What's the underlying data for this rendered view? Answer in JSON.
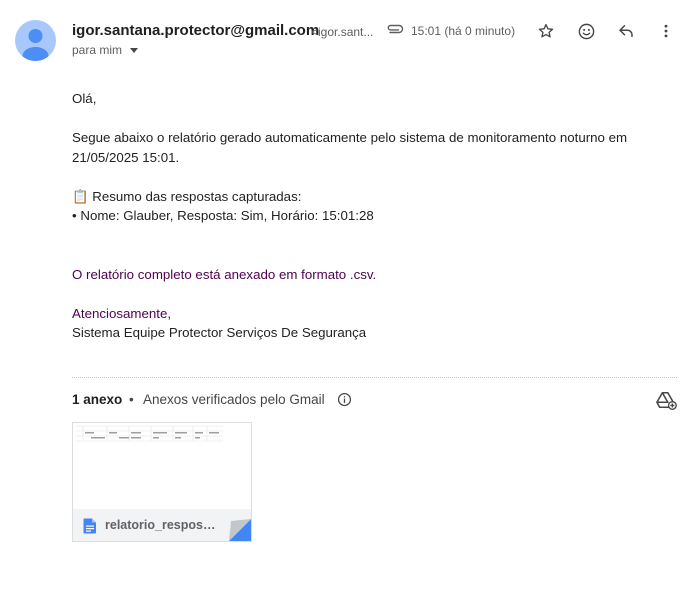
{
  "header": {
    "sender_name": "igor.santana.protector@gmail.com",
    "sender_email": "<igor.sant...",
    "to_line": "para mim",
    "timestamp": "15:01 (há 0 minuto)"
  },
  "icons": {
    "avatar": "person-icon",
    "attachment": "paperclip-icon",
    "star": "star-icon",
    "react": "emoji-icon",
    "reply": "reply-icon",
    "more": "more-vert-icon",
    "info": "info-icon",
    "drive": "add-to-drive-icon",
    "file": "file-icon"
  },
  "body": {
    "greeting": "Olá,",
    "line1": "Segue abaixo o relatório gerado automaticamente pelo sistema de monitoramento noturno em 21/05/2025 15:01.",
    "summary_title": "📋 Resumo das respostas capturadas:",
    "summary_item": "• Nome: Glauber, Resposta: Sim, Horário: 15:01:28",
    "attachment_note": "O relatório completo está anexado em formato .csv.",
    "sign_off": "Atenciosamente,",
    "signature": "Sistema Equipe Protector Serviços De Segurança"
  },
  "attachments": {
    "count_label": "1 anexo",
    "separator": "•",
    "verified_label": "Anexos verificados pelo Gmail",
    "file_name": "relatorio_respost..."
  },
  "colors": {
    "avatar_bg": "#a8c7fa",
    "avatar_fg": "#4c8df6",
    "purple_text": "#500050",
    "file_icon": "#4285f4"
  }
}
